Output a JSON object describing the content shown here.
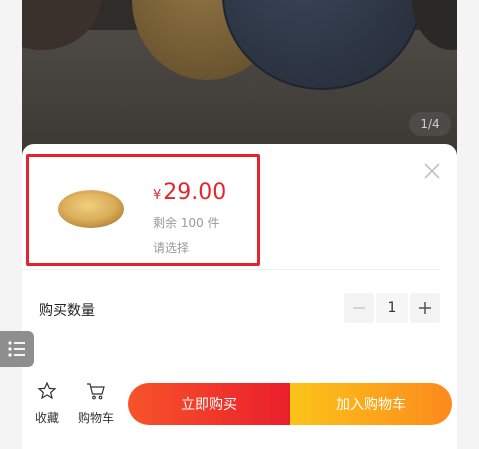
{
  "gallery": {
    "page_indicator": "1/4"
  },
  "sku": {
    "currency": "¥",
    "price": "29.00",
    "stock": "剩余 100 件",
    "choose_hint": "请选择"
  },
  "quantity": {
    "label": "购买数量",
    "value": "1"
  },
  "bottom": {
    "favorite": "收藏",
    "cart": "购物车",
    "buy_now": "立即购买",
    "add_to_cart": "加入购物车"
  },
  "colors": {
    "price": "#e4252e",
    "highlight_border": "#e0252d",
    "buy_gradient": [
      "#f7532b",
      "#ea1f2b"
    ],
    "cart_gradient": [
      "#fbc419",
      "#fd8a1c"
    ]
  },
  "icons": [
    "close-icon",
    "minus-icon",
    "plus-icon",
    "list-menu-icon",
    "star-icon",
    "cart-icon"
  ]
}
